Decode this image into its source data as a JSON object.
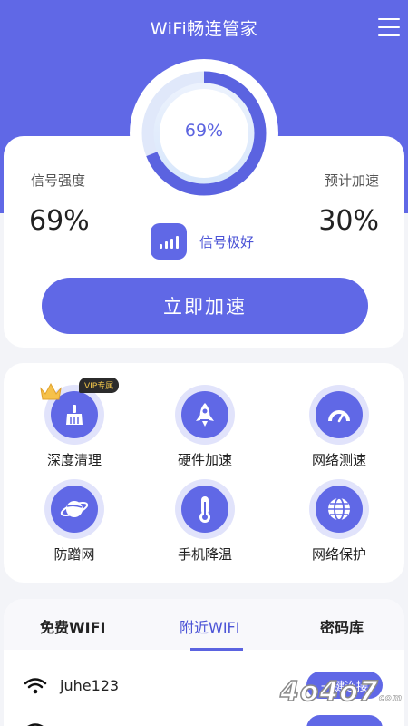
{
  "header": {
    "title": "WiFi畅连管家",
    "menu_icon": "menu-icon"
  },
  "gauge": {
    "value_text": "69%",
    "fraction": 0.69
  },
  "stats": {
    "signal_label": "信号强度",
    "signal_value": "69%",
    "boost_label": "预计加速",
    "boost_value": "30%",
    "quality_text": "信号极好"
  },
  "boost_button": "立即加速",
  "tools": [
    {
      "label": "深度清理",
      "icon": "broom-icon",
      "badge": "VIP专属"
    },
    {
      "label": "硬件加速",
      "icon": "rocket-icon"
    },
    {
      "label": "网络测速",
      "icon": "speedometer-icon"
    },
    {
      "label": "防蹭网",
      "icon": "planet-icon"
    },
    {
      "label": "手机降温",
      "icon": "thermometer-icon"
    },
    {
      "label": "网络保护",
      "icon": "globe-icon"
    }
  ],
  "tabs": [
    {
      "label": "免费WIFI",
      "active": false
    },
    {
      "label": "附近WIFI",
      "active": true
    },
    {
      "label": "密码库",
      "active": false
    }
  ],
  "wifi_list": [
    {
      "name": "juhe123",
      "action": "一键连接"
    },
    {
      "name": "",
      "action": ""
    }
  ],
  "watermark": {
    "text": "4o4o7",
    "suffix": "com"
  },
  "colors": {
    "primary": "#6068e6",
    "accent_text": "#4b53d6",
    "ring_bg": "#e1e3fb"
  }
}
